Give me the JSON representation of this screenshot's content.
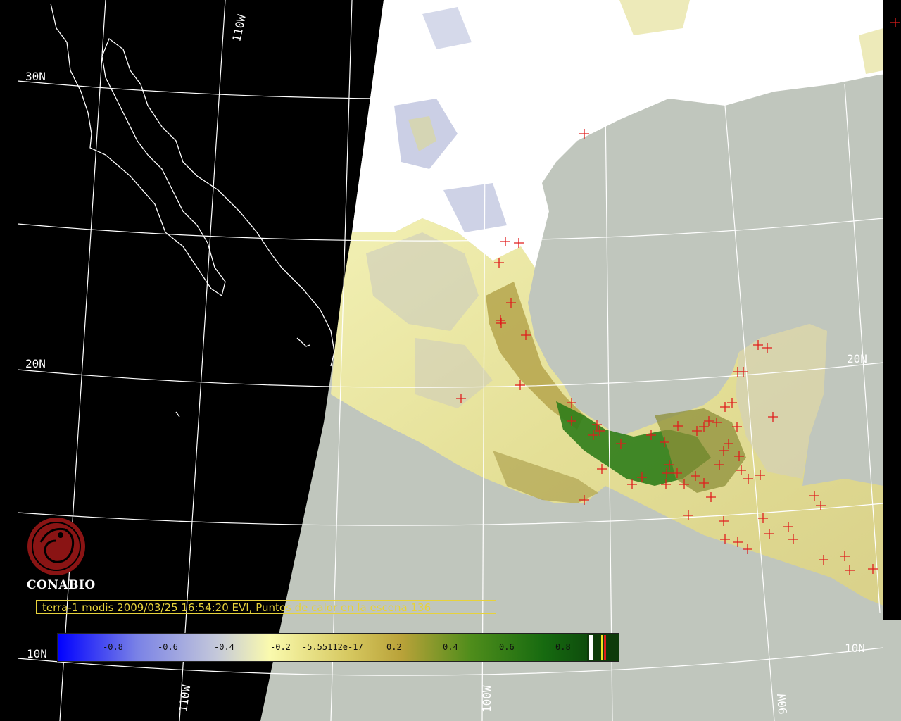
{
  "map": {
    "type": "satellite EVI composite",
    "colors": {
      "background_space": "#000000",
      "cloud": "#ffffff",
      "ocean": "#c0c6bd",
      "veg_low": "#e9e79a",
      "veg_mid": "#a79a46",
      "veg_high": "#2f7d1a",
      "negative": "#8f98c8",
      "fire_marker": "#e01c1c",
      "graticule": "#ffffff",
      "coast": "#ffffff"
    },
    "graticule_labels": {
      "lat_30n_left": "30N",
      "lat_20n_left": "20N",
      "lat_20n_right": "20N",
      "lat_10n_left": "10N",
      "lat_10n_right": "10N",
      "lon_110w_top": "110W",
      "lon_110w_bottom": "110W",
      "lon_100w_bottom": "100W",
      "lon_90w_bottom": "90W"
    },
    "fire_marker_icon": "red-cross-icon"
  },
  "logo": {
    "icon": "conabio-seal-icon",
    "name": "CONABIO"
  },
  "caption": {
    "text": "terra-1 modis 2009/03/25 16:54:20 EVI, Puntos de calor en la escena 136"
  },
  "colorbar": {
    "ticks": [
      "-0.8",
      "-0.6",
      "-0.4",
      "-0.2",
      "-5.55112e-17",
      "0.2",
      "0.4",
      "0.6",
      "0.8"
    ],
    "range": [
      -1.0,
      1.0
    ]
  }
}
